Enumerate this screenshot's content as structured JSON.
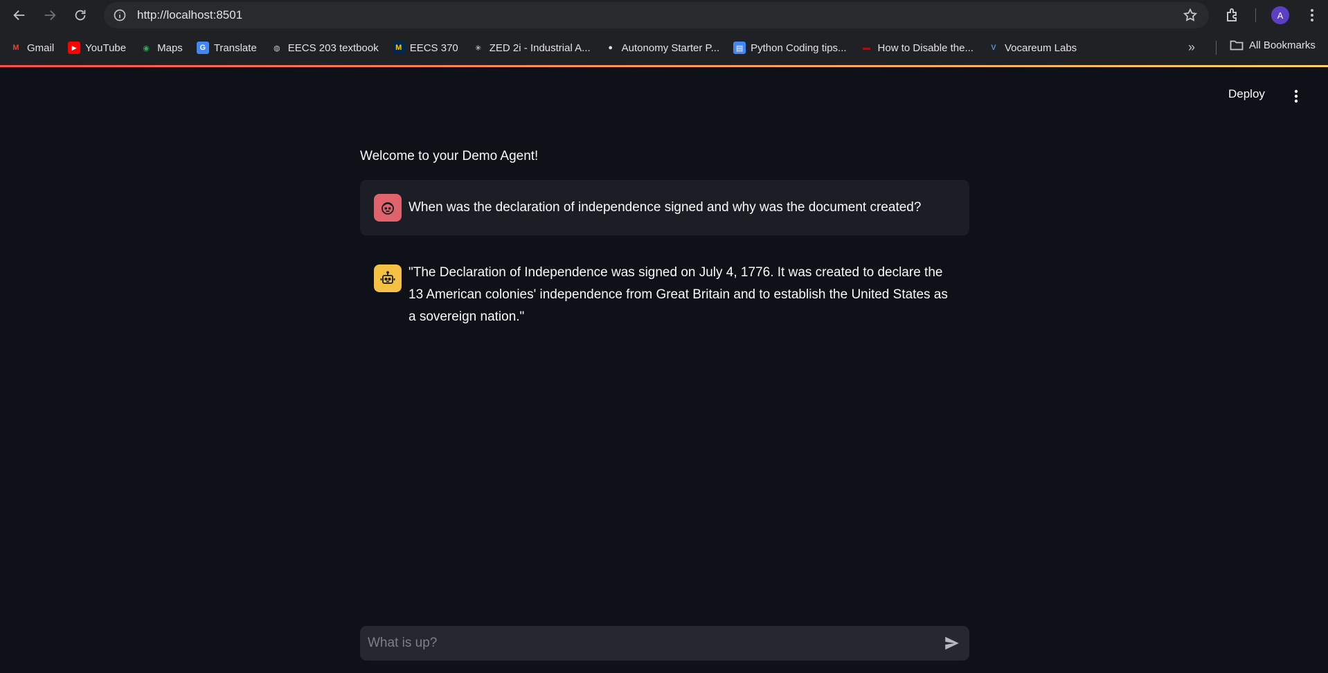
{
  "browser": {
    "url": "http://localhost:8501",
    "profile_initial": "A",
    "bookmarks": [
      {
        "label": "Gmail",
        "icon": "gmail-icon",
        "color": "#ea4335"
      },
      {
        "label": "YouTube",
        "icon": "youtube-icon",
        "color": "#ff0000"
      },
      {
        "label": "Maps",
        "icon": "maps-icon",
        "color": "#34a853"
      },
      {
        "label": "Translate",
        "icon": "translate-icon",
        "color": "#4285f4"
      },
      {
        "label": "EECS 203 textbook",
        "icon": "globe-icon",
        "color": "#c4c7c5"
      },
      {
        "label": "EECS 370",
        "icon": "michigan-icon",
        "color": "#ffcb05"
      },
      {
        "label": "ZED 2i - Industrial A...",
        "icon": "zed-icon",
        "color": "#e3e3e3"
      },
      {
        "label": "Autonomy Starter P...",
        "icon": "github-icon",
        "color": "#e3e3e3"
      },
      {
        "label": "Python Coding tips...",
        "icon": "docs-icon",
        "color": "#4285f4"
      },
      {
        "label": "How to Disable the...",
        "icon": "hp-icon",
        "color": "#cc0000"
      },
      {
        "label": "Vocareum Labs",
        "icon": "vocareum-icon",
        "color": "#4a90d9"
      }
    ],
    "all_bookmarks_label": "All Bookmarks"
  },
  "app": {
    "deploy_label": "Deploy",
    "welcome": "Welcome to your Demo Agent!",
    "messages": [
      {
        "role": "user",
        "text": "When was the declaration of independence signed and why was the document created?"
      },
      {
        "role": "assistant",
        "text": "\"The Declaration of Independence was signed on July 4, 1776. It was created to declare the 13 American colonies' independence from Great Britain and to establish the United States as a sovereign nation.\""
      }
    ],
    "chat_input": {
      "placeholder": "What is up?",
      "value": ""
    }
  },
  "colors": {
    "background": "#0e1117",
    "user_avatar": "#e0636b",
    "bot_avatar": "#f4c142",
    "accent_gradient_start": "#ff4b4b",
    "accent_gradient_end": "#ffd166"
  }
}
